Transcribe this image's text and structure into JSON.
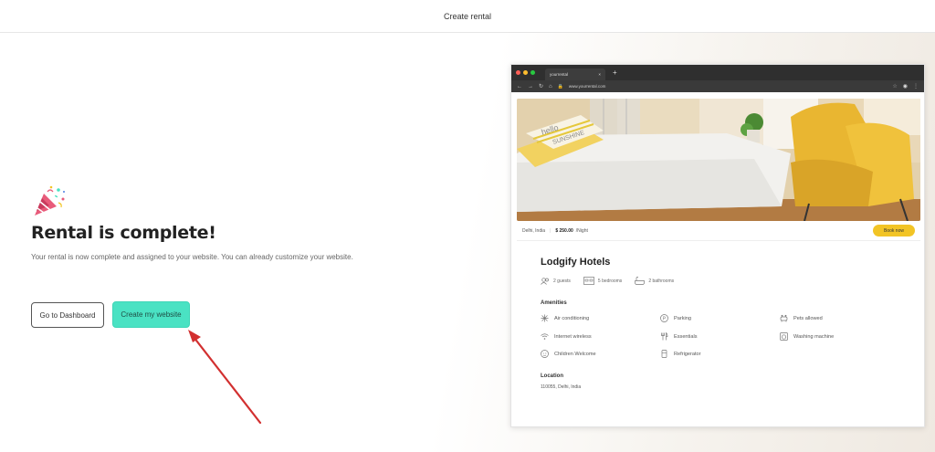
{
  "header": {
    "title": "Create rental"
  },
  "main": {
    "heading": "Rental is complete!",
    "description": "Your rental is now complete and assigned to your website. You can already customize your website.",
    "dashboard_button": "Go to Dashboard",
    "create_button": "Create my website"
  },
  "preview": {
    "tab_title": "yourrental",
    "url": "www.yourrental.com",
    "location": "Delhi, India",
    "price": "$ 250.00",
    "price_unit": "/Night",
    "book_button": "Book now",
    "hotel_name": "Lodgify Hotels",
    "specs": {
      "guests": "2 guests",
      "bedrooms": "5 bedrooms",
      "bathrooms": "2 bathrooms"
    },
    "amenities_title": "Amenities",
    "amenities": [
      "Air conditioning",
      "Parking",
      "Pets allowed",
      "Internet wireless",
      "Essentials",
      "Washing machine",
      "Children Welcome",
      "Refrigerator"
    ],
    "location_title": "Location",
    "location_text": "110055, Delhi, India"
  },
  "colors": {
    "accent": "#4ae2c3",
    "book": "#f2c425",
    "chrome": "#2f2f2f"
  }
}
